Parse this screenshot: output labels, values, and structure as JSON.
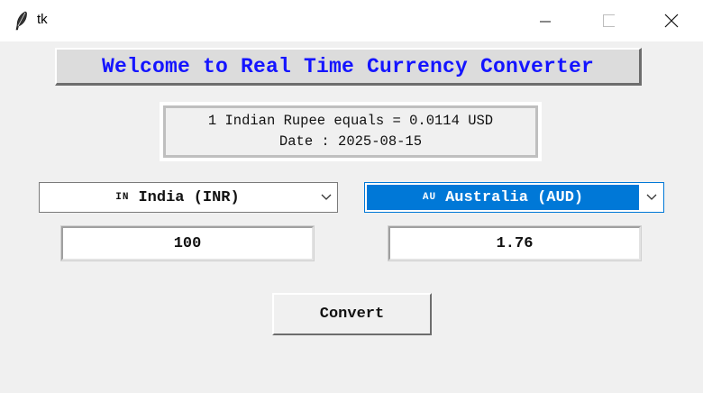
{
  "window": {
    "title": "tk",
    "app_icon": "feather-icon",
    "controls": [
      "minimize-icon",
      "maximize-icon",
      "close-icon"
    ]
  },
  "header": {
    "title": "Welcome to Real Time Currency Converter",
    "title_color": "#1414ff"
  },
  "rate_info": {
    "line1": "1 Indian Rupee equals = 0.0114 USD",
    "line2": "Date : 2025-08-15"
  },
  "from_currency": {
    "flag_code": "IN",
    "label": "India (INR)",
    "amount": "100"
  },
  "to_currency": {
    "flag_code": "AU",
    "label": "Australia (AUD)",
    "amount": "1.76",
    "highlight_color": "#0078d7"
  },
  "actions": {
    "convert_label": "Convert"
  }
}
